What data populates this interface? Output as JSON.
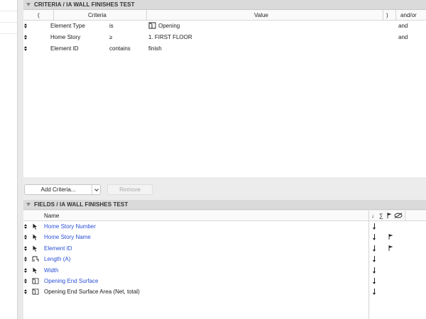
{
  "criteria": {
    "title": "CRITERIA / IA WALL FINISHES TEST",
    "columns": {
      "paren_open": "(",
      "criteria": "Criteria",
      "value": "Value",
      "paren_close": ")",
      "and_or": "and/or"
    },
    "rows": [
      {
        "element": "Element Type",
        "operator": "is",
        "value": "Opening",
        "value_icon": "opening-icon",
        "and_or": "and"
      },
      {
        "element": "Home Story",
        "operator": "≥",
        "value": "1. FIRST FLOOR",
        "and_or": "and"
      },
      {
        "element": "Element ID",
        "operator": "contains",
        "value": "finish",
        "and_or": ""
      }
    ]
  },
  "buttons": {
    "add_criteria": "Add Criteria...",
    "remove": "Remove"
  },
  "fields": {
    "title": "FIELDS / IA WALL FINISHES TEST",
    "columns": {
      "name": "Name",
      "sort": "↓",
      "sum": "∑"
    },
    "rows": [
      {
        "name": "Home Story Number",
        "icon": "cursor-icon",
        "link": true,
        "flag": false
      },
      {
        "name": "Home Story Name",
        "icon": "cursor-icon",
        "link": true,
        "flag": true
      },
      {
        "name": "Element ID",
        "icon": "cursor-icon",
        "link": true,
        "flag": true
      },
      {
        "name": "Length (A)",
        "icon": "length-icon",
        "link": true,
        "flag": false
      },
      {
        "name": "Width",
        "icon": "cursor-icon",
        "link": true,
        "flag": false
      },
      {
        "name": "Opening End Surface",
        "icon": "opening-icon",
        "link": true,
        "flag": false
      },
      {
        "name": "Opening End Surface Area (Net, total)",
        "icon": "opening-icon",
        "link": false,
        "flag": false
      }
    ]
  },
  "colors": {
    "link": "#2a4fd6",
    "header_bg": "#dadada",
    "panel_bg": "#ececec"
  }
}
